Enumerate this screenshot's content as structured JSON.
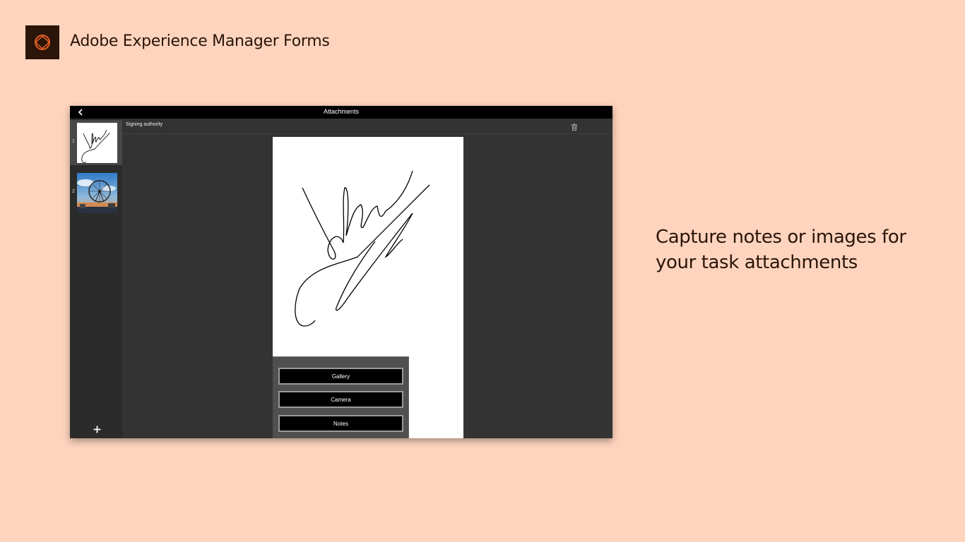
{
  "header": {
    "app_title": "Adobe Experience Manager Forms",
    "logo_icon": "adobe-experience-manager-logo",
    "logo_color": "#E35F24"
  },
  "tagline": {
    "text": "Capture notes or images for your task attachments"
  },
  "device": {
    "topbar": {
      "title": "Attachments",
      "back_icon": "chevron-left-icon"
    },
    "thumbnails": [
      {
        "number": "1",
        "kind": "signature-note",
        "selected": true
      },
      {
        "number": "2",
        "kind": "ferris-wheel-photo",
        "selected": false
      }
    ],
    "add_icon": "plus-icon",
    "content": {
      "title": "Signing authority",
      "trash_icon": "trash-icon"
    },
    "popup": {
      "gallery_label": "Gallery",
      "camera_label": "Camera",
      "notes_label": "Notes"
    }
  },
  "colors": {
    "background": "#FED4BE",
    "text": "#2B1508",
    "logo_bg": "#2B1508",
    "device_bg": "#333333"
  }
}
